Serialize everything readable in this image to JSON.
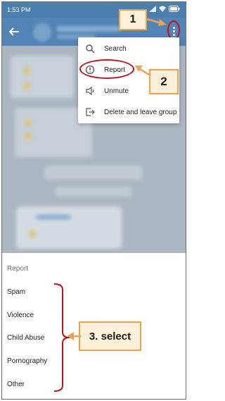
{
  "status_bar": {
    "time": "1:53 PM"
  },
  "header": {
    "back_icon": "arrow-left-icon",
    "more_icon": "more-vert-icon"
  },
  "popup_menu": {
    "items": [
      {
        "label": "Search",
        "icon": "search-icon"
      },
      {
        "label": "Report",
        "icon": "report-icon"
      },
      {
        "label": "Unmute",
        "icon": "speaker-icon"
      },
      {
        "label": "Delete and leave group",
        "icon": "exit-icon"
      }
    ]
  },
  "report_sheet": {
    "title": "Report",
    "options": [
      "Spam",
      "Violence",
      "Child Abuse",
      "Pornography",
      "Other"
    ]
  },
  "annotations": {
    "step1": "1",
    "step2": "2",
    "step3": "3. select",
    "highlight_color": "#c0121a",
    "callout_border": "#f0a14e",
    "callout_fill": "#fdf1d9"
  },
  "colors": {
    "header": "#5285b6",
    "status_bar": "#4a7fb0"
  }
}
